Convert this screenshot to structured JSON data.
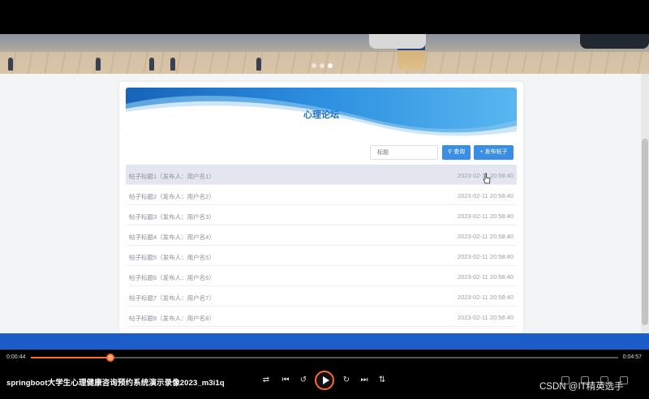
{
  "forum": {
    "title": "心理论坛",
    "search_placeholder": "标题",
    "search_button": "查询",
    "post_button": "发布帖子",
    "search_icon": "search-icon",
    "post_icon": "plus-icon"
  },
  "posts": [
    {
      "title": "帖子标题1（发布人：用户名1）",
      "date": "2023-02-11 20:58:40"
    },
    {
      "title": "帖子标题2（发布人：用户名2）",
      "date": "2023-02-11 20:58:40"
    },
    {
      "title": "帖子标题3（发布人：用户名3）",
      "date": "2023-02-11 20:58:40"
    },
    {
      "title": "帖子标题4（发布人：用户名4）",
      "date": "2023-02-11 20:58:40"
    },
    {
      "title": "帖子标题5（发布人：用户名5）",
      "date": "2023-02-11 20:58:40"
    },
    {
      "title": "帖子标题6（发布人：用户名6）",
      "date": "2023-02-11 20:58:40"
    },
    {
      "title": "帖子标题7（发布人：用户名7）",
      "date": "2023-02-11 20:58:40"
    },
    {
      "title": "帖子标题8（发布人：用户名8）",
      "date": "2023-02-11 20:58:40"
    }
  ],
  "player": {
    "current_time": "0:00:44",
    "total_time": "0:04:57",
    "progress": 0.135,
    "video_title": "springboot大学生心理健康咨询预约系统演示录像2023_m3i1q",
    "watermark": "CSDN @IT精英选手",
    "accent_color": "#ff6b2c"
  },
  "colors": {
    "primary_button": "#3a8ee6",
    "title_blue": "#1e73c8",
    "footer_blue": "#1b5ec9"
  }
}
